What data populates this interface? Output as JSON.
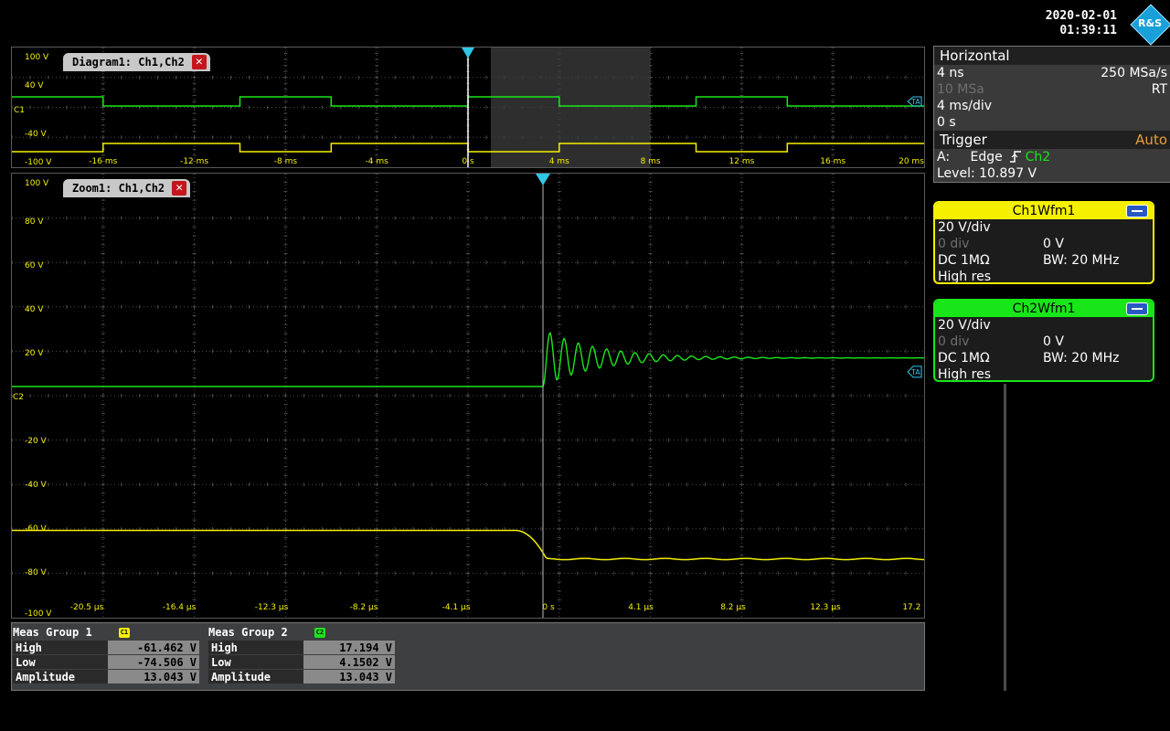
{
  "datetime": {
    "date": "2020-02-01",
    "time": "01:39:11"
  },
  "logo": {
    "text": "R&S"
  },
  "diagram1": {
    "tab_label": "Diagram1: Ch1,Ch2",
    "y_labels": [
      "100 V",
      "40 V",
      "-40 V",
      "-100 V"
    ],
    "x_labels": [
      "-16 ms",
      "-12 ms",
      "-8 ms",
      "-4 ms",
      "0 s",
      "4 ms",
      "8 ms",
      "12 ms",
      "16 ms",
      "20 ms"
    ],
    "ch1_marker": "C1",
    "trigger_marker": "TA"
  },
  "zoom1": {
    "tab_label": "Zoom1: Ch1,Ch2",
    "y_labels": [
      "100 V",
      "80 V",
      "60 V",
      "40 V",
      "20 V",
      "-20 V",
      "-40 V",
      "-60 V",
      "-80 V",
      "-100 V"
    ],
    "x_labels": [
      "-20.5 µs",
      "-16.4 µs",
      "-12.3 µs",
      "-8.2 µs",
      "-4.1 µs",
      "0 s",
      "4.1 µs",
      "8.2 µs",
      "12.3 µs",
      "17.2 µs"
    ],
    "ch2_marker": "C2",
    "trigger_marker": "TA"
  },
  "horizontal": {
    "title": "Horizontal",
    "resolution": "4 ns",
    "sample_rate": "250 MSa/s",
    "record_length": "10 MSa",
    "mode": "RT",
    "time_scale": "4 ms/div",
    "position": "0 s"
  },
  "trigger": {
    "title": "Trigger",
    "mode": "Auto",
    "source_prefix": "A:",
    "type": "Edge",
    "source": "Ch2",
    "level": "Level: 10.897 V"
  },
  "channels": [
    {
      "name": "Ch1Wfm1",
      "color": "#f5f000",
      "scale": "20 V/div",
      "position": "0 div",
      "offset": "0 V",
      "coupling": "DC 1MΩ",
      "bandwidth": "BW: 20 MHz",
      "mode": "High res"
    },
    {
      "name": "Ch2Wfm1",
      "color": "#19e619",
      "scale": "20 V/div",
      "position": "0 div",
      "offset": "0 V",
      "coupling": "DC 1MΩ",
      "bandwidth": "BW: 20 MHz",
      "mode": "High res"
    }
  ],
  "meas_groups": [
    {
      "title": "Meas Group 1",
      "badge": "C1",
      "color": "#f5f000",
      "rows": [
        {
          "label": "High",
          "value": "-61.462 V"
        },
        {
          "label": "Low",
          "value": "-74.506 V"
        },
        {
          "label": "Amplitude",
          "value": "13.043 V"
        }
      ]
    },
    {
      "title": "Meas Group 2",
      "badge": "C2",
      "color": "#19e619",
      "rows": [
        {
          "label": "High",
          "value": "17.194 V"
        },
        {
          "label": "Low",
          "value": "4.1502 V"
        },
        {
          "label": "Amplitude",
          "value": "13.043 V"
        }
      ]
    }
  ],
  "colors": {
    "ch1": "#f5f000",
    "ch2": "#19e619",
    "trigger_marker": "#2ec8e6",
    "grid": "#4a4a4a"
  }
}
